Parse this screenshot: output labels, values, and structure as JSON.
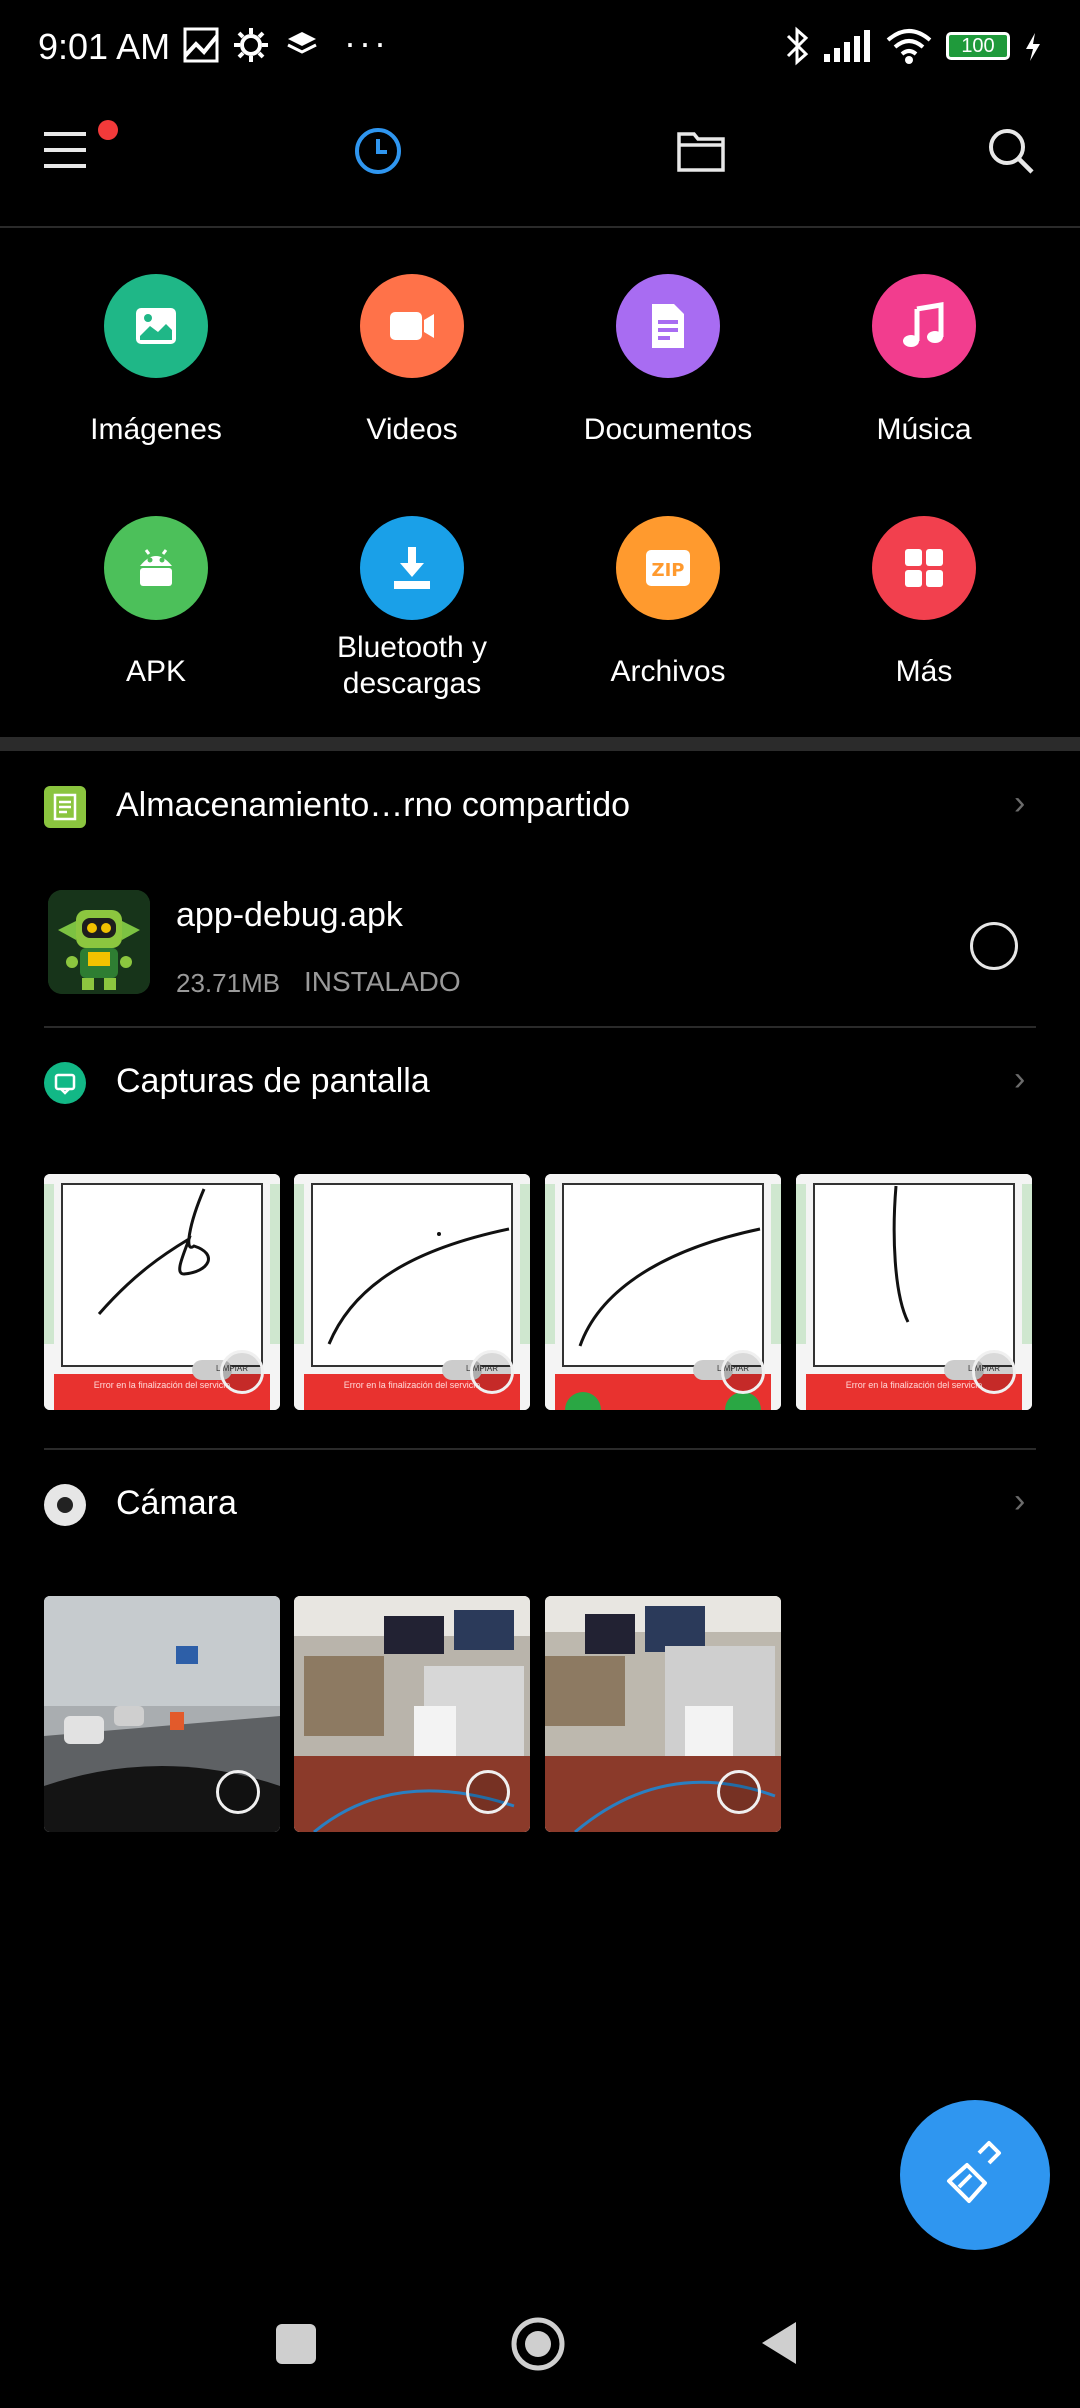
{
  "status_bar": {
    "time": "9:01 AM",
    "battery": "100"
  },
  "top_bar": {
    "icons": [
      "menu-icon",
      "recent-clock-icon",
      "folder-icon",
      "search-icon"
    ]
  },
  "categories": [
    {
      "label": "Imágenes",
      "color": "#1fb787",
      "icon": "image-icon"
    },
    {
      "label": "Videos",
      "color": "#ff7249",
      "icon": "video-icon"
    },
    {
      "label": "Documentos",
      "color": "#a86cf2",
      "icon": "document-icon"
    },
    {
      "label": "Música",
      "color": "#f23d8e",
      "icon": "music-icon"
    },
    {
      "label": "APK",
      "color": "#4cc05a",
      "icon": "android-icon"
    },
    {
      "label": "Bluetooth y descargas",
      "color": "#1aa0e8",
      "icon": "download-icon"
    },
    {
      "label": "Archivos",
      "color": "#ff9a2e",
      "icon": "zip-icon"
    },
    {
      "label": "Más",
      "color": "#f2404e",
      "icon": "grid-icon"
    }
  ],
  "storage_section": {
    "title": "Almacenamiento…rno compartido",
    "file": {
      "name": "app-debug.apk",
      "size": "23.71MB",
      "status": "INSTALADO"
    }
  },
  "screenshots_section": {
    "title": "Capturas de pantalla",
    "thumb_caption": "Error en la finalización del servicio",
    "thumb_button": "LIMPIAR"
  },
  "camera_section": {
    "title": "Cámara"
  },
  "colors": {
    "accent": "#2f96f0",
    "background": "#000000"
  }
}
